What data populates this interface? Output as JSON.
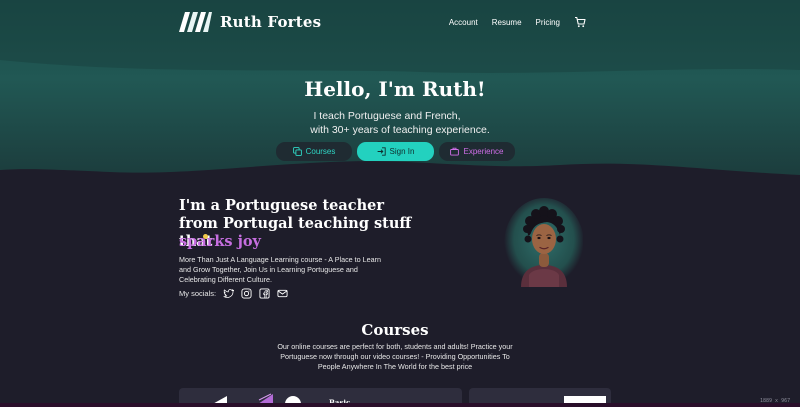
{
  "nav": {
    "brand": "Ruth Fortes",
    "links": [
      "Account",
      "Resume",
      "Pricing"
    ],
    "icons": [
      "cart-icon",
      "moon-icon"
    ]
  },
  "hero": {
    "title": "Hello, I'm Ruth!",
    "subtitle_line1": "I teach Portuguese and French,",
    "subtitle_line2": "with 30+ years of teaching experience.",
    "buttons": [
      {
        "label": "Courses",
        "icon": "copy-icon"
      },
      {
        "label": "Sign In",
        "icon": "sign-in-icon"
      },
      {
        "label": "Experience",
        "icon": "briefcase-icon"
      }
    ]
  },
  "about": {
    "title": "I'm a Portuguese teacher from Portugal teaching stuff that",
    "accent": "sparks joy",
    "description": "More Than Just A Language Learning course - A Place to Learn and Grow Together, Join Us in Learning Portuguese and Celebrating Different Culture.",
    "socials_label": "My socials:",
    "socials": [
      "twitter-icon",
      "instagram-icon",
      "facebook-icon",
      "mail-icon"
    ]
  },
  "courses": {
    "title": "Courses",
    "description": "Our online courses are perfect for both, students and adults! Practice your Portuguese now through our video courses! - Providing Opportunities To People Anywhere In The World for the best price",
    "cards": [
      {
        "label": "Basic"
      }
    ]
  },
  "viewport_readout": "1889 x 967",
  "colors": {
    "background": "#1e1d2a",
    "hero_teal": "#1d4d4a",
    "accent_teal": "#23d1bf",
    "accent_purple": "#c66ee0",
    "card": "#2e2d3d"
  }
}
